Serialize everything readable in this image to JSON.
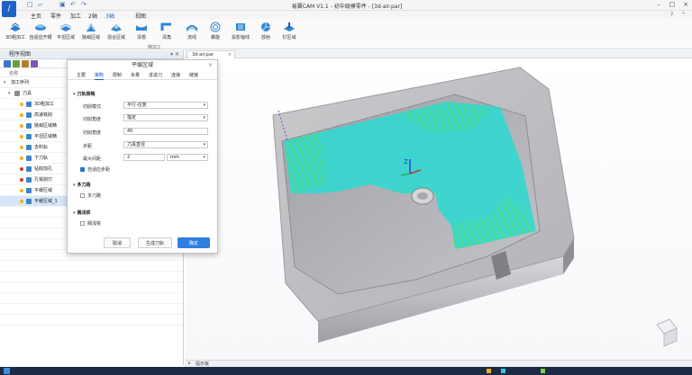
{
  "window": {
    "title": "易翼CAM V1.1 - 初中级模零件 - [3d-air.par]",
    "logo_glyph": "∕"
  },
  "menu": {
    "tabs": [
      "主页",
      "零件",
      "加工",
      "2轴",
      "3轴",
      "视图"
    ],
    "active_tab": "3轴"
  },
  "ribbon": {
    "items": [
      "3D粗加工",
      "自适应开槽",
      "平坦区域",
      "陡峭区域",
      "混合区域",
      "清根",
      "清角",
      "流线",
      "螺旋",
      "投影轴线",
      "放射",
      "钉区域"
    ],
    "group_label": "精加工"
  },
  "tree": {
    "panel_title": "程序视图",
    "column_header": "名称",
    "root": "加工序列",
    "group": "刀具",
    "operations": [
      {
        "label": "3D粗加工",
        "status": "ok"
      },
      {
        "label": "高速铣削",
        "status": "ok"
      },
      {
        "label": "陡峭区域精",
        "status": "ok"
      },
      {
        "label": "平坦区域精",
        "status": "ok"
      },
      {
        "label": "去料轨",
        "status": "ok"
      },
      {
        "label": "下刀轨",
        "status": "ok"
      },
      {
        "label": "钻削加孔",
        "status": "error"
      },
      {
        "label": "孔铣削刃",
        "status": "error"
      },
      {
        "label": "平缓区域",
        "status": "ok"
      },
      {
        "label": "平缓区域_1",
        "status": "ok",
        "selected": true
      }
    ]
  },
  "document": {
    "tab_label": "3d-air.par"
  },
  "status_bar": {
    "label": "提示板"
  },
  "viewport": {
    "axis_label": "Z"
  },
  "dialog": {
    "title": "平缓区域",
    "close": "×",
    "tabs": [
      "主要",
      "策略",
      "限制",
      "余量",
      "进退刀",
      "连接",
      "链接"
    ],
    "active_tab": "策略",
    "sections": {
      "toolpath": "刀轨策略",
      "multipass": "多刀路",
      "skip": "搁浅铁"
    },
    "fields": {
      "cut_mode_label": "切削模式",
      "cut_mode_value": "平行-往复",
      "cut_angle_label": "切削角度",
      "cut_angle_value": "指定",
      "angle_label": "切削角度",
      "angle_value": "45",
      "stepover_label": "步距",
      "stepover_value": "刀具直径",
      "max_step_label": "最大间距",
      "max_step_value": "2",
      "unit_value": "mm",
      "adaptive_label": "自适应步距",
      "multipass_label": "多刀路",
      "skip_label": "搁浅铣"
    },
    "buttons": {
      "cancel": "取消",
      "generate": "生成刀轨",
      "ok": "确定"
    }
  },
  "colors": {
    "accent": "#1f62c5",
    "primary_button": "#2f7fe0",
    "toolpath_cyan": "#35d8d0",
    "toolpath_green": "#5ef04a",
    "error_dot": "#d23a2a",
    "ok_dot": "#f0b21c"
  }
}
